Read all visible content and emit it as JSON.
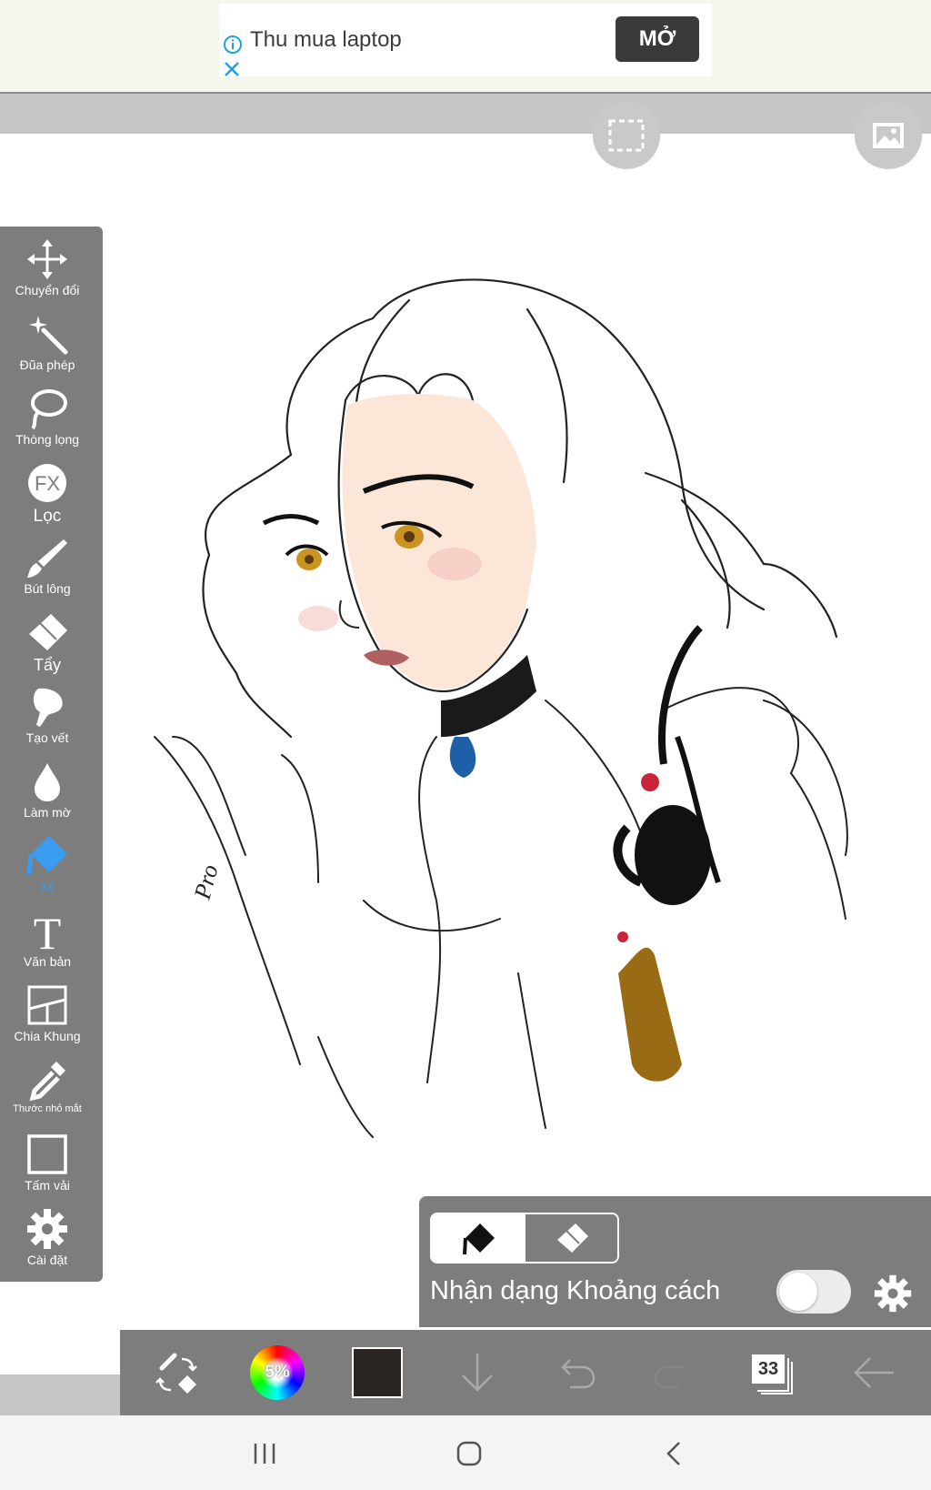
{
  "ad": {
    "text": "Thu mua laptop",
    "button_label": "MỞ",
    "info_icon": "info-icon",
    "close_icon": "close-icon"
  },
  "canvas": {
    "select_icon": "selection-icon",
    "reference_icon": "reference-image-icon",
    "signature": "Pro"
  },
  "toolbar": {
    "active_index": 8,
    "active_color": "#3a9cf0",
    "tools": [
      {
        "label": "Chuyển đổi",
        "icon": "move-icon"
      },
      {
        "label": "Đũa phép",
        "icon": "magic-wand-icon"
      },
      {
        "label": "Thòng lọng",
        "icon": "lasso-icon"
      },
      {
        "label": "Lọc",
        "icon": "fx-filter-icon"
      },
      {
        "label": "Bút lông",
        "icon": "brush-icon"
      },
      {
        "label": "Tẩy",
        "icon": "eraser-icon"
      },
      {
        "label": "Tạo vết",
        "icon": "smudge-icon"
      },
      {
        "label": "Làm mờ",
        "icon": "blur-drop-icon"
      },
      {
        "label": "Xô",
        "icon": "bucket-icon"
      },
      {
        "label": "Văn bản",
        "icon": "text-icon"
      },
      {
        "label": "Chia Khung",
        "icon": "frame-divider-icon"
      },
      {
        "label": "Thước nhỏ mắt",
        "icon": "eyedropper-icon"
      },
      {
        "label": "Tấm vải",
        "icon": "canvas-icon"
      },
      {
        "label": "Cài đặt",
        "icon": "gear-icon"
      }
    ]
  },
  "brush_panel": {
    "mode_fill_icon": "fill-icon",
    "mode_eraser_icon": "eraser-icon",
    "spacing_label": "Nhận dạng Khoảng cách",
    "toggle_on": false,
    "settings_icon": "gear-icon"
  },
  "bottom_bar": {
    "swap_icon": "swap-brush-eraser-icon",
    "brush_size_text": "5%",
    "current_color": "#2b2624",
    "download_icon": "arrow-down-icon",
    "undo_icon": "undo-icon",
    "redo_icon": "redo-icon",
    "layer_count": "33",
    "back_icon": "arrow-left-icon"
  },
  "nav": {
    "recents_icon": "recents-icon",
    "home_icon": "home-icon",
    "back_icon": "back-icon"
  }
}
